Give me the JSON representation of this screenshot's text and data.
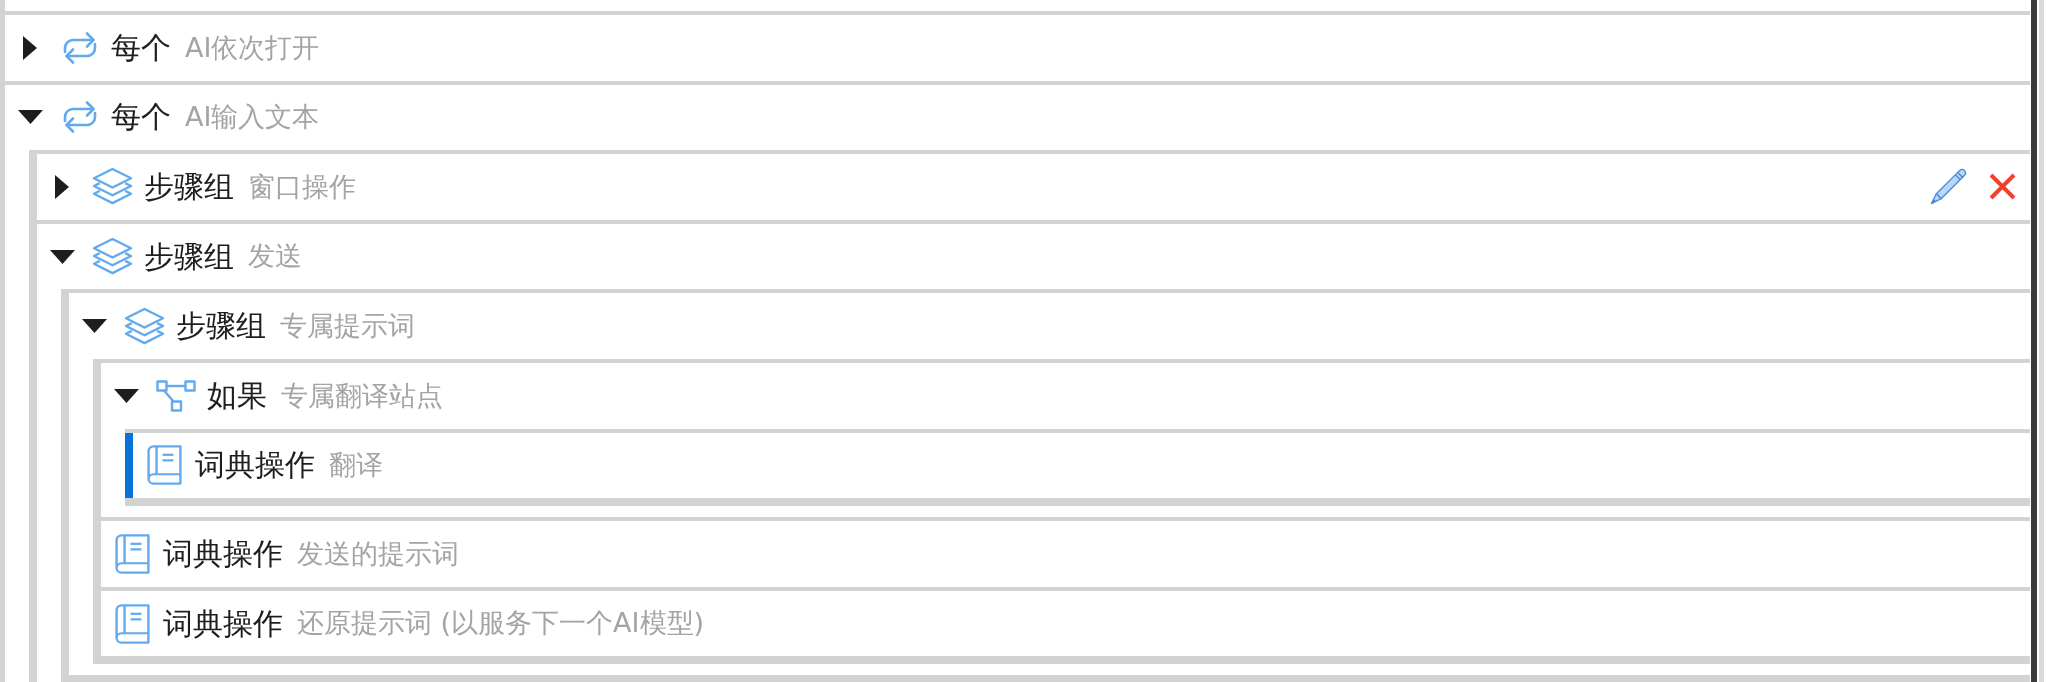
{
  "tree": {
    "nodes": [
      {
        "kind": "loop",
        "title": "每个",
        "subtitle": "AI依次打开",
        "expanded": false,
        "selected": false,
        "hovered": false
      },
      {
        "kind": "loop",
        "title": "每个",
        "subtitle": "AI输入文本",
        "expanded": true,
        "selected": false,
        "hovered": false,
        "children": [
          {
            "kind": "group",
            "title": "步骤组",
            "subtitle": "窗口操作",
            "expanded": false,
            "selected": false,
            "hovered": true
          },
          {
            "kind": "group",
            "title": "步骤组",
            "subtitle": "发送",
            "expanded": true,
            "selected": false,
            "hovered": false,
            "children": [
              {
                "kind": "group",
                "title": "步骤组",
                "subtitle": "专属提示词",
                "expanded": true,
                "selected": false,
                "hovered": false,
                "children": [
                  {
                    "kind": "condition",
                    "title": "如果",
                    "subtitle": "专属翻译站点",
                    "expanded": true,
                    "selected": false,
                    "hovered": false,
                    "children": [
                      {
                        "kind": "dictionary",
                        "title": "词典操作",
                        "subtitle": "翻译",
                        "selected": true,
                        "hovered": false
                      }
                    ]
                  },
                  {
                    "kind": "dictionary",
                    "title": "词典操作",
                    "subtitle": "发送的提示词",
                    "selected": false,
                    "hovered": false
                  },
                  {
                    "kind": "dictionary",
                    "title": "词典操作",
                    "subtitle": "还原提示词 (以服务下一个AI模型)",
                    "selected": false,
                    "hovered": false
                  }
                ]
              }
            ]
          }
        ]
      }
    ]
  }
}
